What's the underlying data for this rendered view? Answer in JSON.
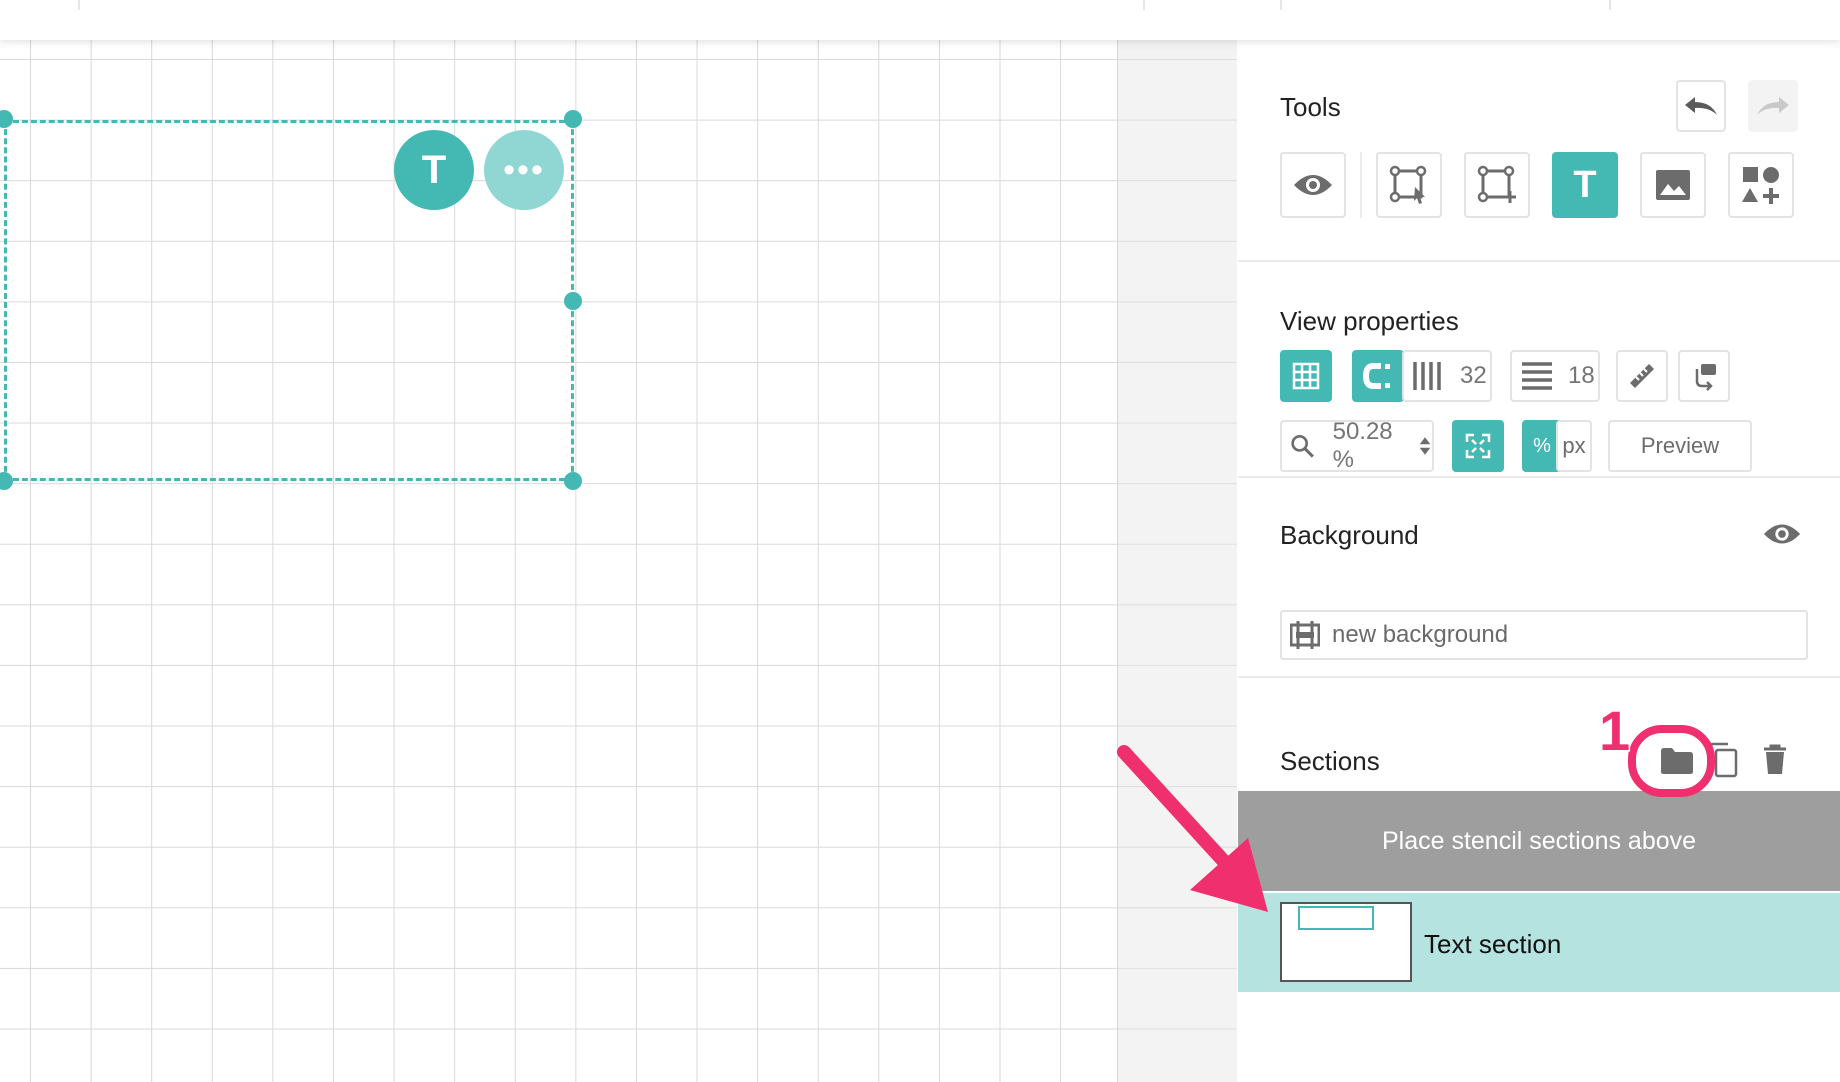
{
  "canvas": {
    "text_tool_badge": "T",
    "more_badge": "•••"
  },
  "annotation": {
    "step_number": "1",
    "accent_color": "#f0306e"
  },
  "panel": {
    "tools": {
      "title": "Tools",
      "undo_icon": "undo-icon",
      "redo_icon": "redo-icon",
      "items": [
        {
          "name": "eye-icon"
        },
        {
          "name": "select-frame-icon"
        },
        {
          "name": "add-frame-icon"
        },
        {
          "name": "text-tool-icon",
          "label": "T",
          "active": true
        },
        {
          "name": "image-icon"
        },
        {
          "name": "add-shapes-icon"
        }
      ]
    },
    "view_properties": {
      "title": "View properties",
      "columns_value": "32",
      "rows_value": "18",
      "zoom_value": "50.28 %",
      "unit_percent": "%",
      "unit_px": "px",
      "preview_label": "Preview"
    },
    "background": {
      "title": "Background",
      "field_value": "new background"
    },
    "sections": {
      "title": "Sections",
      "stencil_placeholder": "Place stencil sections above",
      "items": [
        {
          "label": "Text section"
        }
      ]
    }
  },
  "colors": {
    "accent": "#44b9b3",
    "accent_light": "#b4e3e0",
    "stencil_bg": "#9e9e9e"
  }
}
